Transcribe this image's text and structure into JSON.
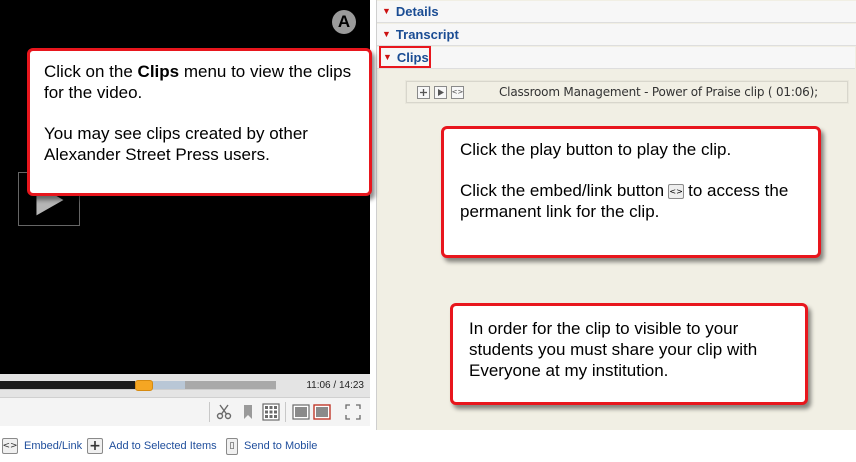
{
  "player": {
    "logo_letter": "A",
    "progress": {
      "played_fraction": 0.49,
      "buffered_end_fraction": 0.67,
      "thumb_fraction": 0.52
    },
    "time": {
      "current": "11:06",
      "separator": "/",
      "total": "14:23"
    }
  },
  "panel": {
    "sections": [
      {
        "label": "Details"
      },
      {
        "label": "Transcript"
      },
      {
        "label": "Clips"
      }
    ],
    "clip": {
      "title": "Classroom Management - Power of Praise clip ( 01:06);"
    }
  },
  "actions": [
    {
      "label": "Embed/Link",
      "icon": "embed-icon"
    },
    {
      "label": "Add to Selected Items",
      "icon": "plus-icon"
    },
    {
      "label": "Send to Mobile",
      "icon": "mobile-icon"
    }
  ],
  "callouts": {
    "clips": {
      "p1_before": "Click on the ",
      "p1_bold": "Clips",
      "p1_after": " menu to view the clips for the video.",
      "p2": "You may see clips created by other Alexander Street Press users."
    },
    "play": {
      "p1": "Click the play button to play the clip.",
      "p2_before": "Click the embed/link button",
      "p2_after": "to access the permanent link for the clip."
    },
    "share": {
      "text": "In order for the clip to visible to your students you must share your clip with Everyone at my institution."
    }
  },
  "colors": {
    "accent_red": "#e8161d",
    "link_blue": "#1a4c93",
    "panel_bg": "#f1efe4"
  }
}
